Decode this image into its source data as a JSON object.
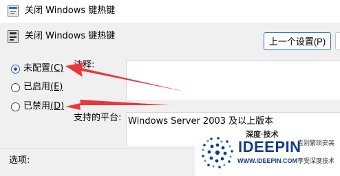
{
  "window": {
    "title": "关闭 Windows 键热键"
  },
  "header": {
    "title": "关闭 Windows 键热键",
    "prev_button": "上一个设置(P)",
    "next_button": ""
  },
  "options": [
    {
      "label": "未配置",
      "access": "(C)",
      "checked": true
    },
    {
      "label": "已启用",
      "access": "(E)",
      "checked": false
    },
    {
      "label": "已禁用",
      "access": "(D)",
      "checked": false
    }
  ],
  "comment": {
    "label": "注释:",
    "value": ""
  },
  "supported": {
    "label": "支持的平台:",
    "value": "Windows Server 2003 及以上版本"
  },
  "options_section": {
    "label": "选项:"
  },
  "annotation": {
    "arrow_color": "#e8383d"
  },
  "watermark": {
    "cn_name": "深度·技术",
    "brand": "IDEEPIN",
    "url": "WWW.IDEEPIN.COM",
    "tagline_1": "告别繁琐安装",
    "tagline_2": "享受深度技术"
  }
}
